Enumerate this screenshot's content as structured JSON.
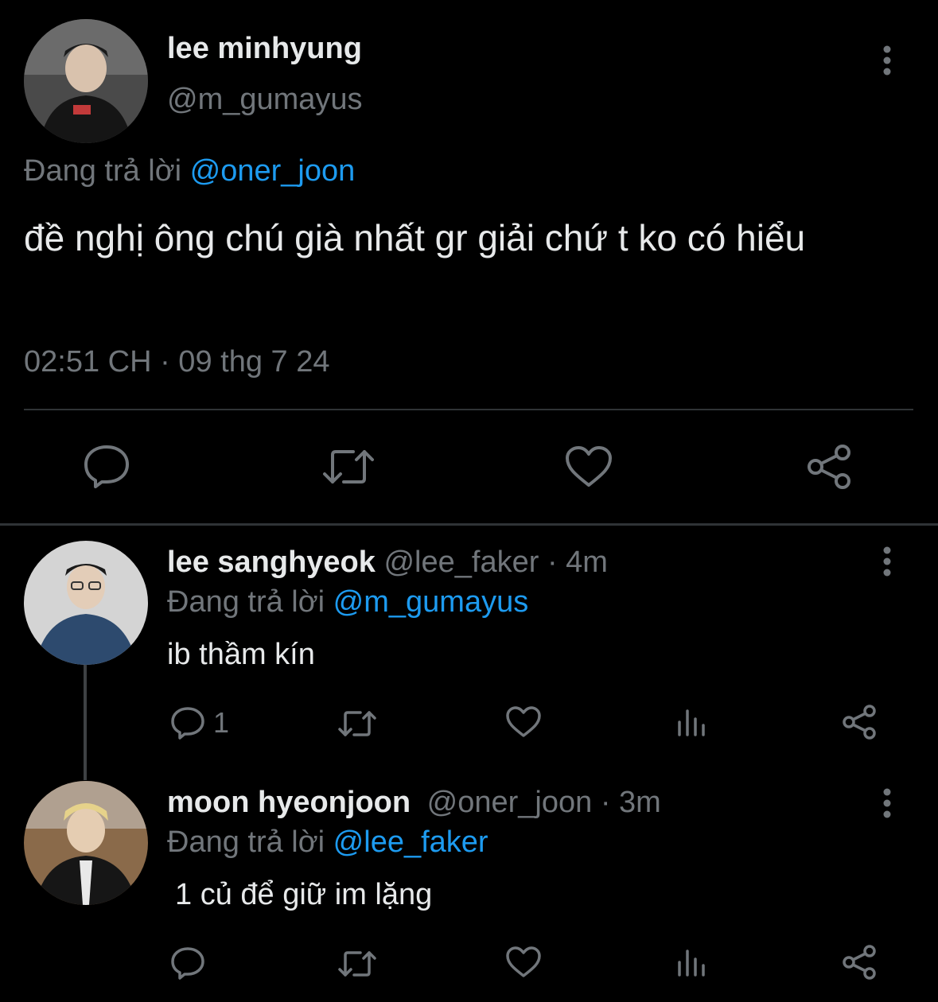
{
  "main_tweet": {
    "display_name": "lee minhyung",
    "handle": "@m_gumayus",
    "replying_label": "Đang trả lời",
    "replying_to": "@oner_joon",
    "text": "đề nghị ông chú già nhất gr giải chứ t ko có hiểu",
    "timestamp": "02:51 CH · 09 thg 7 24",
    "actions": [
      "reply-icon",
      "retweet-icon",
      "like-icon",
      "share-icon"
    ]
  },
  "replies": [
    {
      "display_name": "lee sanghyeok",
      "handle": "@lee_faker",
      "time": "· 4m",
      "replying_label": "Đang trả lời",
      "replying_to": "@m_gumayus",
      "text": "ib thầm kín",
      "reply_count": "1"
    },
    {
      "display_name": "moon hyeonjoon",
      "handle": "@oner_joon",
      "time": "· 3m",
      "replying_label": "Đang trả lời",
      "replying_to": "@lee_faker",
      "text": "1 củ để giữ im lặng",
      "reply_count": ""
    }
  ],
  "colors": {
    "background": "#000000",
    "text": "#e7e9ea",
    "muted": "#71767b",
    "link": "#1d9bf0",
    "divider": "#2f3336"
  }
}
